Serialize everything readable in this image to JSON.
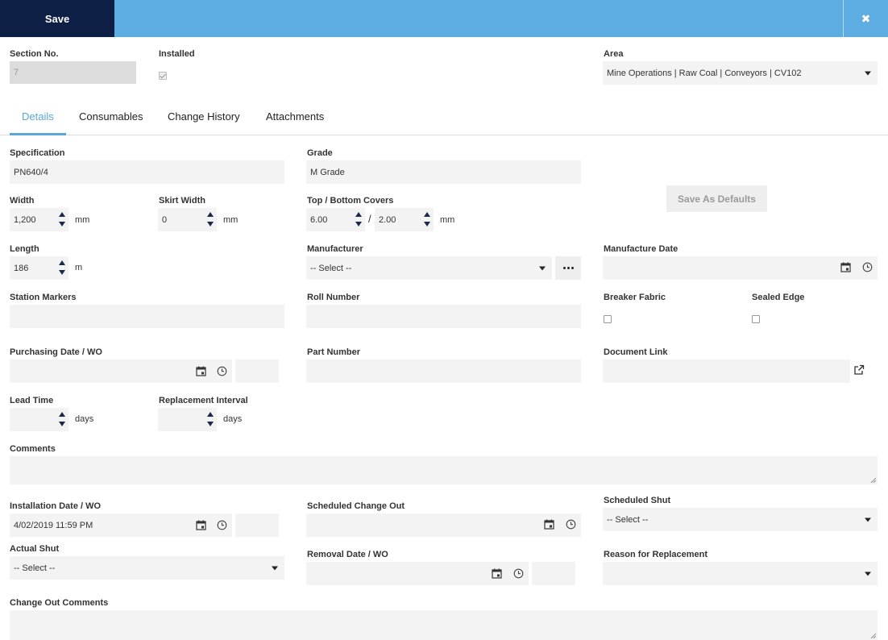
{
  "toolbar": {
    "save_label": "Save",
    "close_glyph": "✖"
  },
  "header": {
    "section_no_label": "Section No.",
    "section_no_value": "7",
    "installed_label": "Installed",
    "installed_checked": true,
    "area_label": "Area",
    "area_value": "Mine Operations | Raw Coal | Conveyors | CV102"
  },
  "tabs": [
    {
      "label": "Details",
      "active": true
    },
    {
      "label": "Consumables",
      "active": false
    },
    {
      "label": "Change History",
      "active": false
    },
    {
      "label": "Attachments",
      "active": false
    }
  ],
  "form": {
    "specification": {
      "label": "Specification",
      "value": "PN640/4"
    },
    "grade": {
      "label": "Grade",
      "value": "M Grade"
    },
    "width": {
      "label": "Width",
      "value": "1,200",
      "unit": "mm"
    },
    "skirt_width": {
      "label": "Skirt Width",
      "value": "0",
      "unit": "mm"
    },
    "covers": {
      "label": "Top / Bottom Covers",
      "top": "6.00",
      "separator": "/",
      "bottom": "2.00",
      "unit": "mm"
    },
    "save_defaults_label": "Save As Defaults",
    "length": {
      "label": "Length",
      "value": "186",
      "unit": "m"
    },
    "manufacturer": {
      "label": "Manufacturer",
      "value": "-- Select --"
    },
    "manufacture_date": {
      "label": "Manufacture Date",
      "value": ""
    },
    "station_markers": {
      "label": "Station Markers",
      "value": ""
    },
    "roll_number": {
      "label": "Roll Number",
      "value": ""
    },
    "breaker_fabric": {
      "label": "Breaker Fabric",
      "checked": false
    },
    "sealed_edge": {
      "label": "Sealed Edge",
      "checked": false
    },
    "purchasing": {
      "label": "Purchasing Date / WO",
      "date": "",
      "wo": ""
    },
    "part_number": {
      "label": "Part Number",
      "value": ""
    },
    "document_link": {
      "label": "Document Link",
      "value": ""
    },
    "lead_time": {
      "label": "Lead Time",
      "value": "",
      "unit": "days"
    },
    "replacement_interval": {
      "label": "Replacement Interval",
      "value": "",
      "unit": "days"
    },
    "comments": {
      "label": "Comments",
      "value": ""
    },
    "installation": {
      "label": "Installation Date / WO",
      "date": "4/02/2019 11:59 PM",
      "wo": ""
    },
    "scheduled_change_out": {
      "label": "Scheduled Change Out",
      "value": ""
    },
    "scheduled_shut": {
      "label": "Scheduled Shut",
      "value": "-- Select --"
    },
    "actual_shut": {
      "label": "Actual Shut",
      "value": "-- Select --"
    },
    "removal": {
      "label": "Removal Date / WO",
      "date": "",
      "wo": ""
    },
    "reason_for_replacement": {
      "label": "Reason for Replacement",
      "value": ""
    },
    "change_out_comments": {
      "label": "Change Out Comments",
      "value": ""
    }
  },
  "colors": {
    "header_bar": "#5dade2",
    "save_button": "#0d1f45",
    "active_tab": "#5aa6d8",
    "field_bg": "#f3f3f3"
  },
  "icons": [
    "close-icon",
    "calendar-icon",
    "clock-icon",
    "external-link-icon",
    "ellipsis-icon",
    "chevron-down-icon",
    "spinner-up-icon",
    "spinner-down-icon"
  ]
}
